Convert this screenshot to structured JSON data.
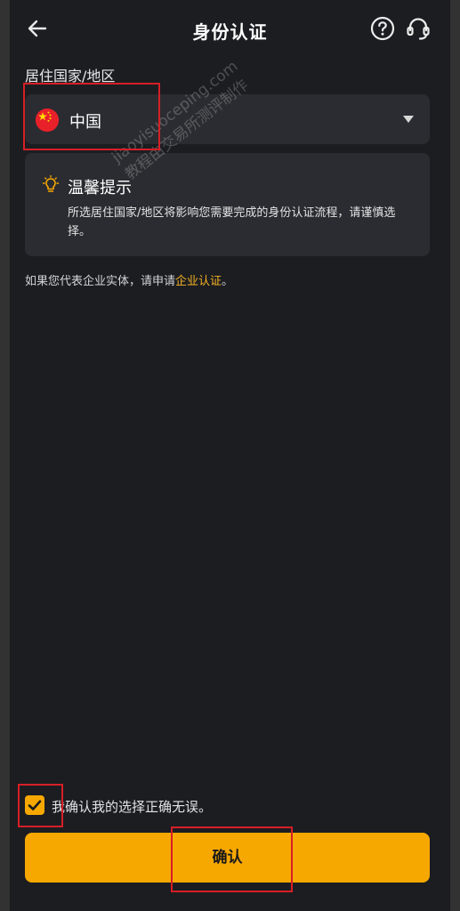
{
  "header": {
    "title": "身份认证",
    "back_icon": "arrow-left-icon",
    "help_icon": "question-circle-icon",
    "support_icon": "headset-icon"
  },
  "residence": {
    "label": "居住国家/地区",
    "selected_country": "中国",
    "flag_icon": "china-flag-icon",
    "dropdown_icon": "caret-down-icon"
  },
  "tip": {
    "icon": "lightbulb-icon",
    "title": "温馨提示",
    "text": "所选居住国家/地区将影响您需要完成的身份认证流程，请谨慎选择。"
  },
  "enterprise": {
    "prefix": "如果您代表企业实体，请申请",
    "link": "企业认证",
    "suffix": "。"
  },
  "confirmation": {
    "checked": true,
    "text": "我确认我的选择正确无误。"
  },
  "confirm_button": {
    "label": "确认"
  },
  "watermark": {
    "line1": "jiaoyisuoceping.com",
    "line2": "教程由交易所测评制作"
  },
  "colors": {
    "background": "#1c1d21",
    "card": "#2b2c31",
    "accent": "#f7a800",
    "link": "#f5b324",
    "annotation": "#d61f26"
  }
}
